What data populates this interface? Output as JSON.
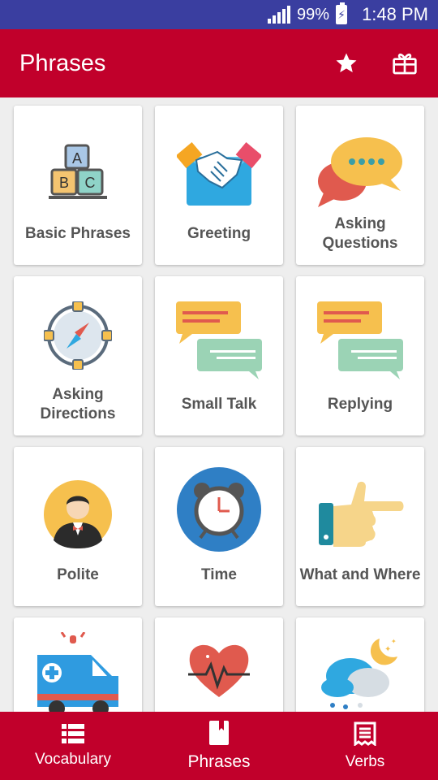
{
  "status": {
    "battery": "99%",
    "time": "1:48 PM"
  },
  "appbar": {
    "title": "Phrases",
    "icons": [
      "star-icon",
      "gift-icon"
    ]
  },
  "categories": [
    {
      "label": "Basic Phrases",
      "icon": "abc-blocks-icon"
    },
    {
      "label": "Greeting",
      "icon": "handshake-icon"
    },
    {
      "label": "Asking Questions",
      "icon": "speech-bubbles-icon"
    },
    {
      "label": "Asking Directions",
      "icon": "compass-icon"
    },
    {
      "label": "Small Talk",
      "icon": "chat-messages-icon"
    },
    {
      "label": "Replying",
      "icon": "chat-messages-icon"
    },
    {
      "label": "Polite",
      "icon": "gentleman-avatar-icon"
    },
    {
      "label": "Time",
      "icon": "alarm-clock-icon"
    },
    {
      "label": "What and Where",
      "icon": "pointing-hand-icon"
    },
    {
      "label": "",
      "icon": "ambulance-icon"
    },
    {
      "label": "",
      "icon": "heartbeat-icon"
    },
    {
      "label": "",
      "icon": "weather-night-icon"
    }
  ],
  "bottom_nav": [
    {
      "label": "Vocabulary",
      "icon": "list-icon"
    },
    {
      "label": "Phrases",
      "icon": "book-icon"
    },
    {
      "label": "Verbs",
      "icon": "receipt-icon"
    }
  ],
  "colors": {
    "primary": "#c1002b",
    "statusbar": "#3a3ea0"
  }
}
